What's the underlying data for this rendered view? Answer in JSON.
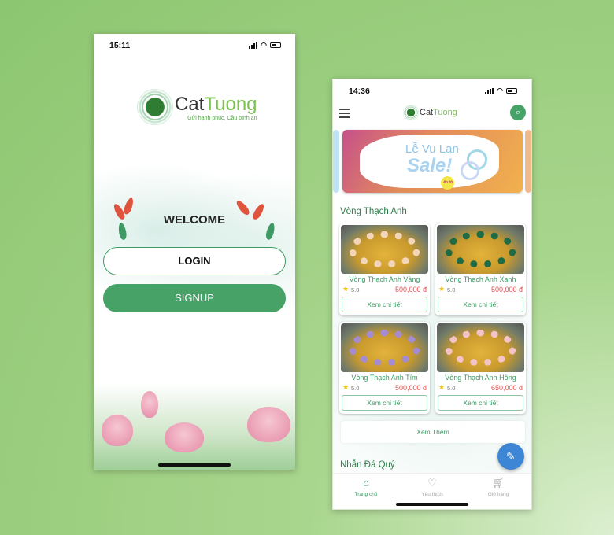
{
  "login_screen": {
    "status": {
      "time": "15:11"
    },
    "logo": {
      "brand": "CatTuong",
      "brand_part1": "Cat",
      "brand_part2": "Tuong",
      "tagline": "Gửi hạnh phúc, Cầu bình an"
    },
    "welcome": "WELCOME",
    "login_label": "LOGIN",
    "signup_label": "SIGNUP"
  },
  "home_screen": {
    "status": {
      "time": "14:36"
    },
    "logo": {
      "brand_part1": "Cat",
      "brand_part2": "Tuong"
    },
    "banner": {
      "line1": "Lễ Vu Lan",
      "line2": "Sale!",
      "badge": "Lên tới 50%"
    },
    "section1_title": "Vòng Thạch Anh",
    "products": [
      {
        "name": "Vòng Thạch Anh Vàng",
        "rating": "5.0",
        "price": "500,000 đ",
        "button": "Xem chi tiết",
        "bead_color": "#f3d6b8"
      },
      {
        "name": "Vòng Thạch Anh Xanh",
        "rating": "5.0",
        "price": "500,000 đ",
        "button": "Xem chi tiết",
        "bead_color": "#1f6b45"
      },
      {
        "name": "Vòng Thạch Anh Tím",
        "rating": "5.0",
        "price": "500,000 đ",
        "button": "Xem chi tiết",
        "bead_color": "#a58bd0"
      },
      {
        "name": "Vòng Thạch Anh Hồng",
        "rating": "5.0",
        "price": "650,000 đ",
        "button": "Xem chi tiết",
        "bead_color": "#f3c3c6"
      }
    ],
    "more_label": "Xem Thêm",
    "section2_title": "Nhẫn Đá Quý",
    "nav": [
      {
        "label": "Trang chủ",
        "icon": "home-icon",
        "active": true
      },
      {
        "label": "Yêu thích",
        "icon": "heart-icon",
        "active": false
      },
      {
        "label": "Giỏ hàng",
        "icon": "cart-icon",
        "active": false
      }
    ]
  },
  "colors": {
    "primary": "#47a267",
    "price": "#e0524f",
    "fab": "#3d86d6"
  }
}
